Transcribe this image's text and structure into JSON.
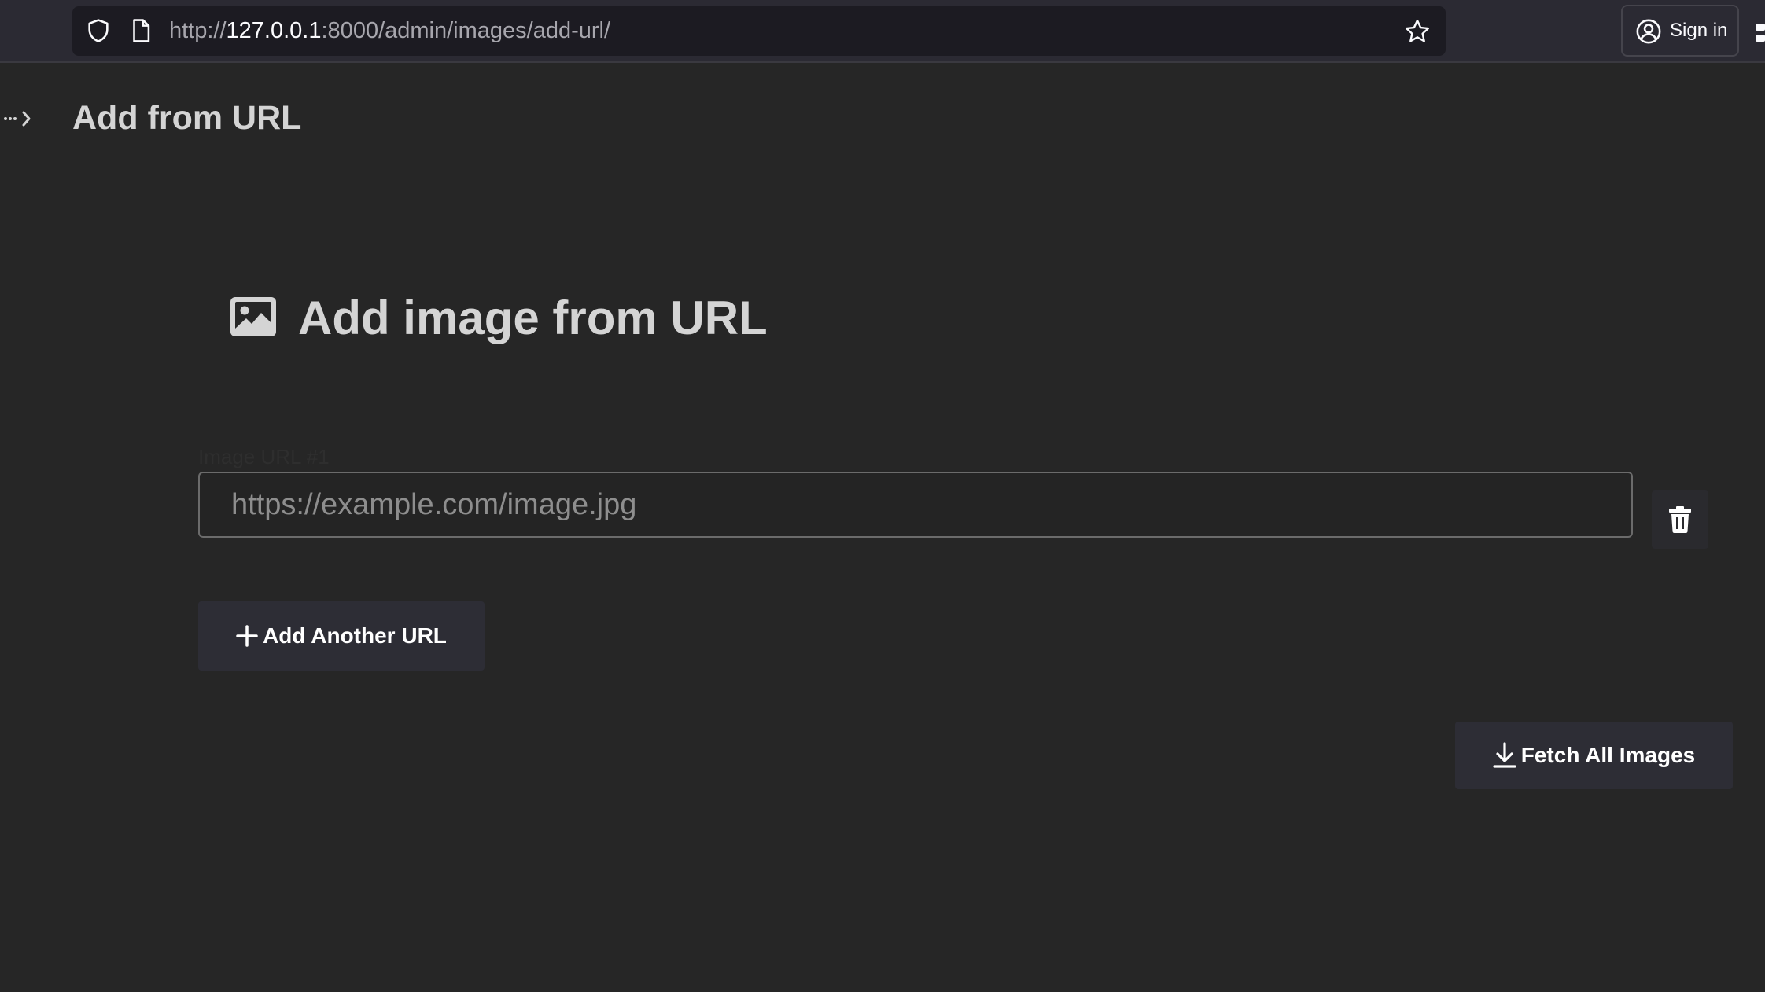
{
  "browser": {
    "url_scheme": "http://",
    "url_host": "127.0.0.1",
    "url_path": ":8000/admin/images/add-url/",
    "signin_label": "Sign in",
    "icons": [
      "shield-icon",
      "page-icon",
      "star-icon",
      "user-icon",
      "overflow-icon"
    ]
  },
  "header": {
    "title": "Add from URL",
    "toggle_icon": "sidebar-toggle-icon"
  },
  "main": {
    "heading": "Add image from URL",
    "heading_icon": "image-icon",
    "field_label": "Image URL #1",
    "url_input": {
      "value": "",
      "placeholder": "https://example.com/image.jpg"
    },
    "delete_icon": "trash-icon",
    "add_another_label": "Add Another URL",
    "fetch_all_label": "Fetch All Images"
  },
  "colors": {
    "background": "#262626",
    "toolbar": "#2b2a33",
    "button": "#2d2d35",
    "text": "#d4d4d4"
  }
}
